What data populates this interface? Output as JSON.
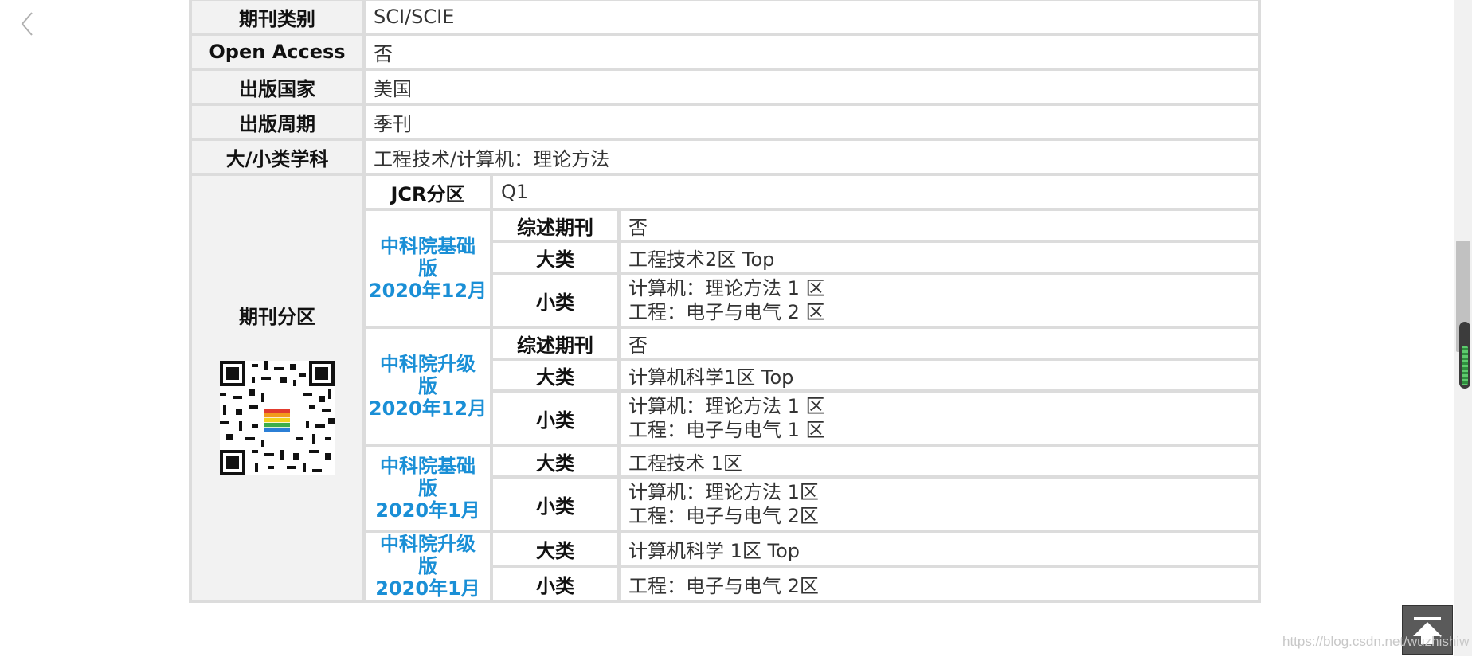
{
  "nav": {
    "back_icon": "chevron-left-icon"
  },
  "rows": [
    {
      "label": "期刊类别",
      "value": "SCI/SCIE"
    },
    {
      "label": "Open Access",
      "value": "否"
    },
    {
      "label": "出版国家",
      "value": "美国"
    },
    {
      "label": "出版周期",
      "value": "季刊"
    },
    {
      "label": "大/小类学科",
      "value": "工程技术/计算机：理论方法"
    }
  ],
  "partition": {
    "label": "期刊分区",
    "jcr_label": "JCR分区",
    "jcr_value": "Q1",
    "groups": [
      {
        "version": [
          "中科院基础",
          "版",
          "2020年12月"
        ],
        "review_label": "综述期刊",
        "review_value": "否",
        "major_label": "大类",
        "major_value": "工程技术2区 Top",
        "minor_label": "小类",
        "minor_lines": [
          "计算机：理论方法 1 区",
          "工程：电子与电气 2 区"
        ]
      },
      {
        "version": [
          "中科院升级",
          "版",
          "2020年12月"
        ],
        "review_label": "综述期刊",
        "review_value": "否",
        "major_label": "大类",
        "major_value": "计算机科学1区 Top",
        "minor_label": "小类",
        "minor_lines": [
          "计算机：理论方法 1 区",
          "工程：电子与电气 1 区"
        ]
      },
      {
        "version": [
          "中科院基础",
          "版",
          "2020年1月"
        ],
        "major_label": "大类",
        "major_value": "工程技术 1区",
        "minor_label": "小类",
        "minor_lines": [
          "计算机：理论方法 1区",
          "工程：电子与电气 2区"
        ]
      },
      {
        "version": [
          "中科院升级",
          "版",
          "2020年1月"
        ],
        "major_label": "大类",
        "major_value": "计算机科学 1区 Top",
        "minor_label": "小类",
        "minor_lines": [
          "工程：电子与电气 2区"
        ]
      }
    ]
  },
  "qr_icon": "qr-code-icon",
  "back_to_top_icon": "arrow-up-icon",
  "watermark": "https://blog.csdn.net/wuzhishiw",
  "colors": {
    "version_link": "#1a8fd6",
    "label_bg": "#f2f2f2",
    "border": "#dcdcdc"
  }
}
